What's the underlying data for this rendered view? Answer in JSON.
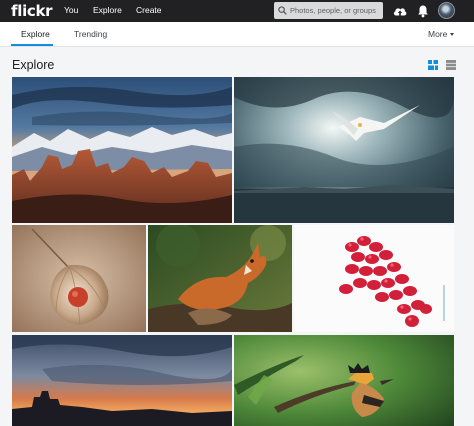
{
  "brand": {
    "logo_text": "flickr"
  },
  "topnav": {
    "you": "You",
    "explore": "Explore",
    "create": "Create"
  },
  "search": {
    "placeholder": "Photos, people, or groups"
  },
  "icons": {
    "upload": "cloud-upload-icon",
    "notifications": "bell-icon",
    "search": "search-icon",
    "grid_view": "justified-grid-icon",
    "list_view": "square-view-icon"
  },
  "tabs": [
    {
      "label": "Explore",
      "active": true
    },
    {
      "label": "Trending",
      "active": false
    }
  ],
  "more": {
    "label": "More"
  },
  "main": {
    "title": "Explore"
  },
  "photos": [
    {
      "name": "desert-arch-sunset-photo"
    },
    {
      "name": "seagull-storm-clouds-photo"
    },
    {
      "name": "lantern-husk-macro-photo"
    },
    {
      "name": "fox-kits-photo"
    },
    {
      "name": "pomegranate-seeds-photo"
    },
    {
      "name": "castle-dusk-sky-photo"
    },
    {
      "name": "hoopoe-bird-photo"
    }
  ],
  "colors": {
    "topbar": "#212124",
    "accent": "#128fdc",
    "page_bg": "#f3f5f6",
    "active_view": "#128fdc",
    "inactive_view": "#898d90"
  }
}
